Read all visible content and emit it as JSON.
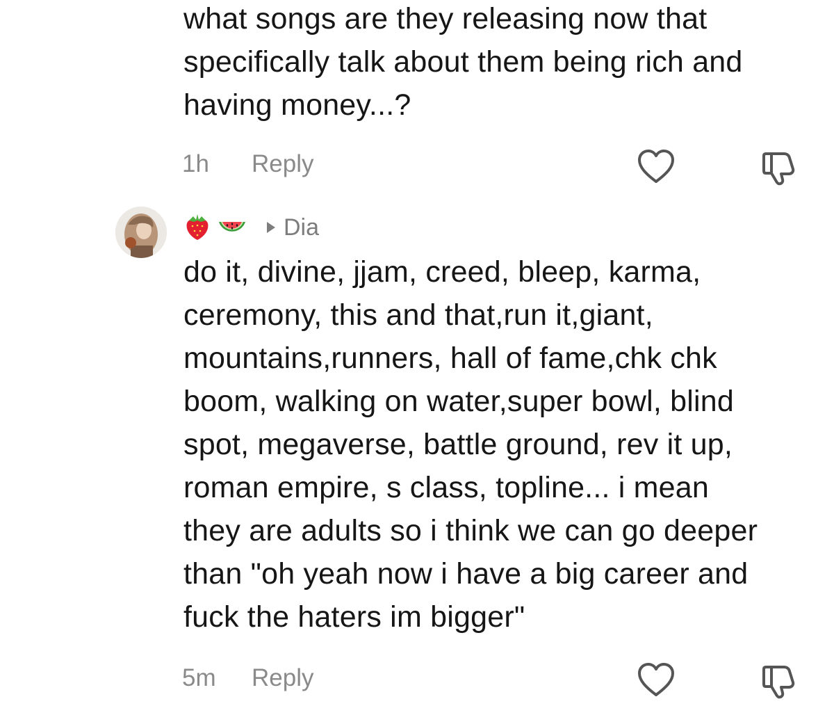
{
  "comments": [
    {
      "text": "what songs are they releasing now that\nspecifically talk about them being rich and\nhaving money...?",
      "time": "1h",
      "reply_label": "Reply",
      "icons": [
        "heart-icon",
        "dislike-icon"
      ]
    },
    {
      "username_emojis": [
        "strawberry-icon",
        "watermelon-icon"
      ],
      "reply_to": "Dia",
      "text": "do it, divine, jjam, creed, bleep, karma,\nceremony, this and that,run it,giant,\nmountains,runners, hall of fame,chk chk\nboom, walking on water,super bowl, blind\nspot, megaverse, battle ground, rev it up,\nroman empire, s class, topline... i mean\nthey are adults so i think we can go deeper\nthan \"oh yeah now i have a big career and\nfuck the haters im bigger\"",
      "time": "5m",
      "reply_label": "Reply",
      "icons": [
        "heart-icon",
        "dislike-icon"
      ]
    }
  ],
  "colors": {
    "text": "#161616",
    "meta": "#8a8a8a",
    "icon_stroke": "#555555"
  }
}
